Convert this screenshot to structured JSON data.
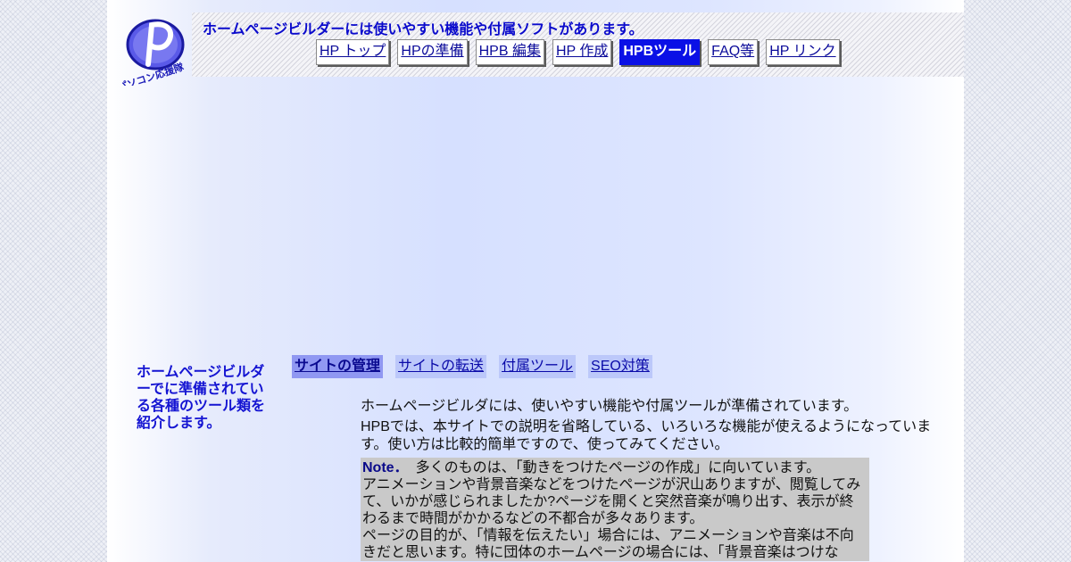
{
  "header": {
    "logo_text": "パソコン応援隊",
    "tagline": "ホームページビルダーには使いやすい機能や付属ソフトがあります。",
    "nav": [
      {
        "label": "HP トップ",
        "active": false
      },
      {
        "label": "HPの準備",
        "active": false
      },
      {
        "label": "HPB 編集",
        "active": false
      },
      {
        "label": "HP 作成",
        "active": false
      },
      {
        "label": "HPBツール",
        "active": true
      },
      {
        "label": "FAQ等",
        "active": false
      },
      {
        "label": "HP リンク",
        "active": false
      }
    ]
  },
  "sidebar": {
    "description": "ホームページビルダーでに準備されている各種のツール類を紹介します。"
  },
  "subnav": [
    {
      "label": "サイトの管理",
      "active": true
    },
    {
      "label": "サイトの転送",
      "active": false
    },
    {
      "label": "付属ツール",
      "active": false
    },
    {
      "label": "SEO対策",
      "active": false
    }
  ],
  "content": {
    "intro1": "ホームページビルダには、使いやすい機能や付属ツールが準備されています。",
    "intro2": "HPBでは、本サイトでの説明を省略している、いろいろな機能が使えるようになっています。使い方は比較的簡単ですので、使ってみてください。",
    "note_label": "Note．",
    "note_first": "　多くのものは、「動きをつけたページの作成」に向いています。",
    "note_para1": "アニメーションや背景音楽などをつけたページが沢山ありますが、閲覧してみて、いかが感じられましたか?ページを開くと突然音楽が鳴り出す、表示が終わるまで時間がかかるなどの不都合が多々あります。",
    "note_para2": "ページの目的が、「情報を伝えたい」場合には、アニメーションや音楽は不向きだと思います。特に団体のホームページの場合には、「背景音楽はつけな"
  },
  "colors": {
    "accent_blue": "#0a10e6",
    "heading_blue": "#1414d2",
    "note_bg": "#c9c9c9"
  }
}
